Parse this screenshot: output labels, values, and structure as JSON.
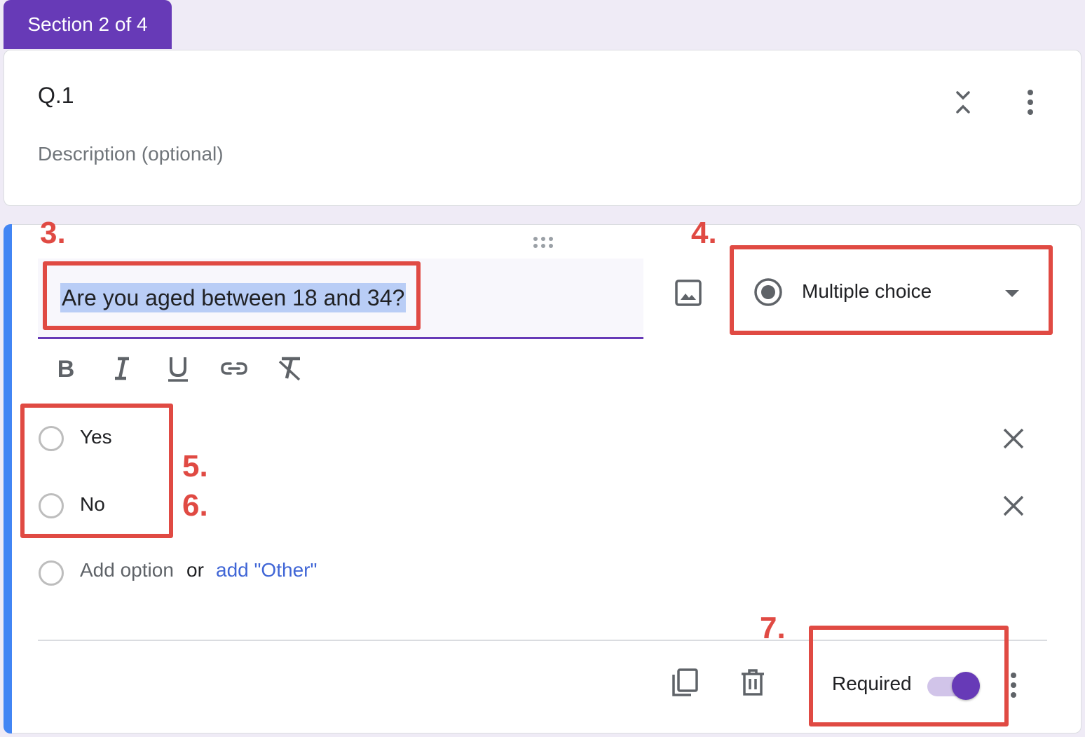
{
  "section_tab": {
    "label": "Section 2 of 4"
  },
  "section_header": {
    "title": "Q.1",
    "description_placeholder": "Description (optional)",
    "icons": [
      "collapse-icon",
      "more-vert-icon"
    ]
  },
  "question": {
    "title": "Are you aged between 18 and 34?",
    "type": "Multiple choice",
    "format_toolbar": [
      "bold-icon",
      "italic-icon",
      "underline-icon",
      "link-icon",
      "clear-format-icon"
    ],
    "options": [
      {
        "label": "Yes"
      },
      {
        "label": "No"
      }
    ],
    "add_option": "Add option",
    "or": "or",
    "add_other": "add \"Other\"",
    "footer": {
      "required_label": "Required",
      "required_on": true,
      "icons": [
        "copy-icon",
        "delete-icon",
        "more-vert-icon"
      ]
    }
  },
  "annotations": {
    "a3": "3.",
    "a4": "4.",
    "a5": "5.",
    "a6": "6.",
    "a7": "7."
  },
  "colors": {
    "accent": "#673ab7",
    "annotation": "#e04a43",
    "link": "#4066d6",
    "selection": "#b9cdf6"
  }
}
